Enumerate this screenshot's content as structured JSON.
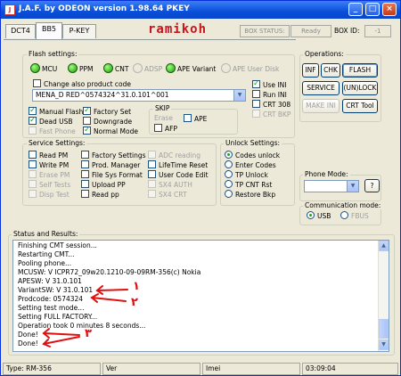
{
  "window": {
    "icon_text": "J",
    "title": "J.A.F. by ODEON version 1.98.64 PKEY",
    "buttons": [
      "minimize-icon",
      "maximize-icon",
      "close-icon"
    ]
  },
  "tabs": [
    "DCT4",
    "BB5",
    "P-KEY"
  ],
  "active_tab": "BB5",
  "brand": "ramikoh",
  "box_status": {
    "label": "BOX STATUS:",
    "value": "Ready"
  },
  "box_id": {
    "label": "BOX ID:",
    "value": "-1"
  },
  "flash_settings": {
    "title": "Flash settings:",
    "leds": [
      {
        "label": "MCU",
        "on": true
      },
      {
        "label": "PPM",
        "on": true
      },
      {
        "label": "CNT",
        "on": true
      },
      {
        "label": "ADSP",
        "on": false
      },
      {
        "label": "APE Variant",
        "on": true
      },
      {
        "label": "APE User Disk",
        "on": false
      }
    ],
    "change_product_code": "Change also product code",
    "product_code_value": "MENA_D RED^0574324^31.0.101^001",
    "right_options": [
      {
        "label": "Use INI",
        "checked": true,
        "enabled": true
      },
      {
        "label": "Run INI",
        "checked": false,
        "enabled": true
      },
      {
        "label": "CRT 308",
        "checked": false,
        "enabled": true
      },
      {
        "label": "CRT BKP",
        "checked": false,
        "enabled": false
      }
    ],
    "options_col1": [
      {
        "label": "Manual Flash",
        "checked": true,
        "enabled": true
      },
      {
        "label": "Dead USB",
        "checked": true,
        "enabled": true
      },
      {
        "label": "Fast Phone",
        "checked": false,
        "enabled": false
      }
    ],
    "options_col2": [
      {
        "label": "Factory Set",
        "checked": true,
        "enabled": true
      },
      {
        "label": "Downgrade",
        "checked": false,
        "enabled": true
      },
      {
        "label": "Normal Mode",
        "checked": true,
        "enabled": true
      }
    ],
    "skip": {
      "title": "SKIP",
      "erase": {
        "label": "Erase",
        "checked": false,
        "enabled": false
      },
      "ape": {
        "label": "APE",
        "checked": false,
        "enabled": true
      },
      "afp": {
        "label": "AFP",
        "checked": false,
        "enabled": true
      }
    }
  },
  "operations": {
    "title": "Operations:",
    "buttons": [
      {
        "label": "INF",
        "enabled": true
      },
      {
        "label": "CHK",
        "enabled": true
      },
      {
        "label": "FLASH",
        "enabled": true
      },
      {
        "label": "SERVICE",
        "enabled": true
      },
      {
        "label": "(UN)LOCK",
        "enabled": true
      },
      {
        "label": "MAKE INI",
        "enabled": false
      },
      {
        "label": "CRT Tool",
        "enabled": true
      }
    ]
  },
  "service_settings": {
    "title": "Service Settings:",
    "col1": [
      {
        "label": "Read PM",
        "checked": false,
        "enabled": true
      },
      {
        "label": "Write PM",
        "checked": false,
        "enabled": true
      },
      {
        "label": "Erase PM",
        "checked": false,
        "enabled": false
      },
      {
        "label": "Self Tests",
        "checked": false,
        "enabled": false
      },
      {
        "label": "Disp Test",
        "checked": false,
        "enabled": false
      }
    ],
    "col2": [
      {
        "label": "Factory Settings",
        "checked": false,
        "enabled": true
      },
      {
        "label": "Prod. Manager",
        "checked": false,
        "enabled": true
      },
      {
        "label": "File Sys Format",
        "checked": false,
        "enabled": true
      },
      {
        "label": "Upload PP",
        "checked": false,
        "enabled": true
      },
      {
        "label": "Read pp",
        "checked": false,
        "enabled": true
      }
    ],
    "col3": [
      {
        "label": "ADC reading",
        "checked": false,
        "enabled": false
      },
      {
        "label": "LifeTime Reset",
        "checked": false,
        "enabled": true
      },
      {
        "label": "User Code Edit",
        "checked": false,
        "enabled": true
      },
      {
        "label": "SX4 AUTH",
        "checked": false,
        "enabled": false
      },
      {
        "label": "SX4 CRT",
        "checked": false,
        "enabled": false
      }
    ]
  },
  "unlock_settings": {
    "title": "Unlock Settings:",
    "options": [
      {
        "label": "Codes unlock",
        "selected": true
      },
      {
        "label": "Enter Codes",
        "selected": false
      },
      {
        "label": "TP Unlock",
        "selected": false
      },
      {
        "label": "TP CNT Rst",
        "selected": false
      },
      {
        "label": "Restore Bkp",
        "selected": false
      }
    ]
  },
  "phone_mode": {
    "title": "Phone Mode:",
    "value": "",
    "help_label": "?"
  },
  "communication_mode": {
    "title": "Communication mode:",
    "options": [
      {
        "label": "USB",
        "selected": true,
        "enabled": true
      },
      {
        "label": "FBUS",
        "selected": false,
        "enabled": false
      }
    ]
  },
  "status_results": {
    "title": "Status and Results:",
    "lines": [
      "Finishing CMT session...",
      "Restarting CMT...",
      "Pooling phone...",
      "MCUSW: V ICPR72_09w20.1210-09-09RM-356(c) Nokia",
      "APESW: V 31.0.101",
      "VariantSW: V 31.0.101",
      "Prodcode: 0574324",
      "Setting test mode...",
      "Setting FULL FACTORY...",
      "Operation took 0 minutes 8 seconds...",
      "Done!",
      "Done!"
    ],
    "annotations": [
      "١",
      "٢",
      "٣"
    ]
  },
  "statusbar": {
    "type": "Type: RM-356",
    "ver": "Ver",
    "imei": "Imei",
    "time": "03:09:04"
  },
  "colors": {
    "title_blue": "#0a4fd9",
    "brand_red": "#c6161d",
    "led_green": "#1e9b0e",
    "annotation_red": "#e01010",
    "window_bg": "#ece9d8"
  }
}
